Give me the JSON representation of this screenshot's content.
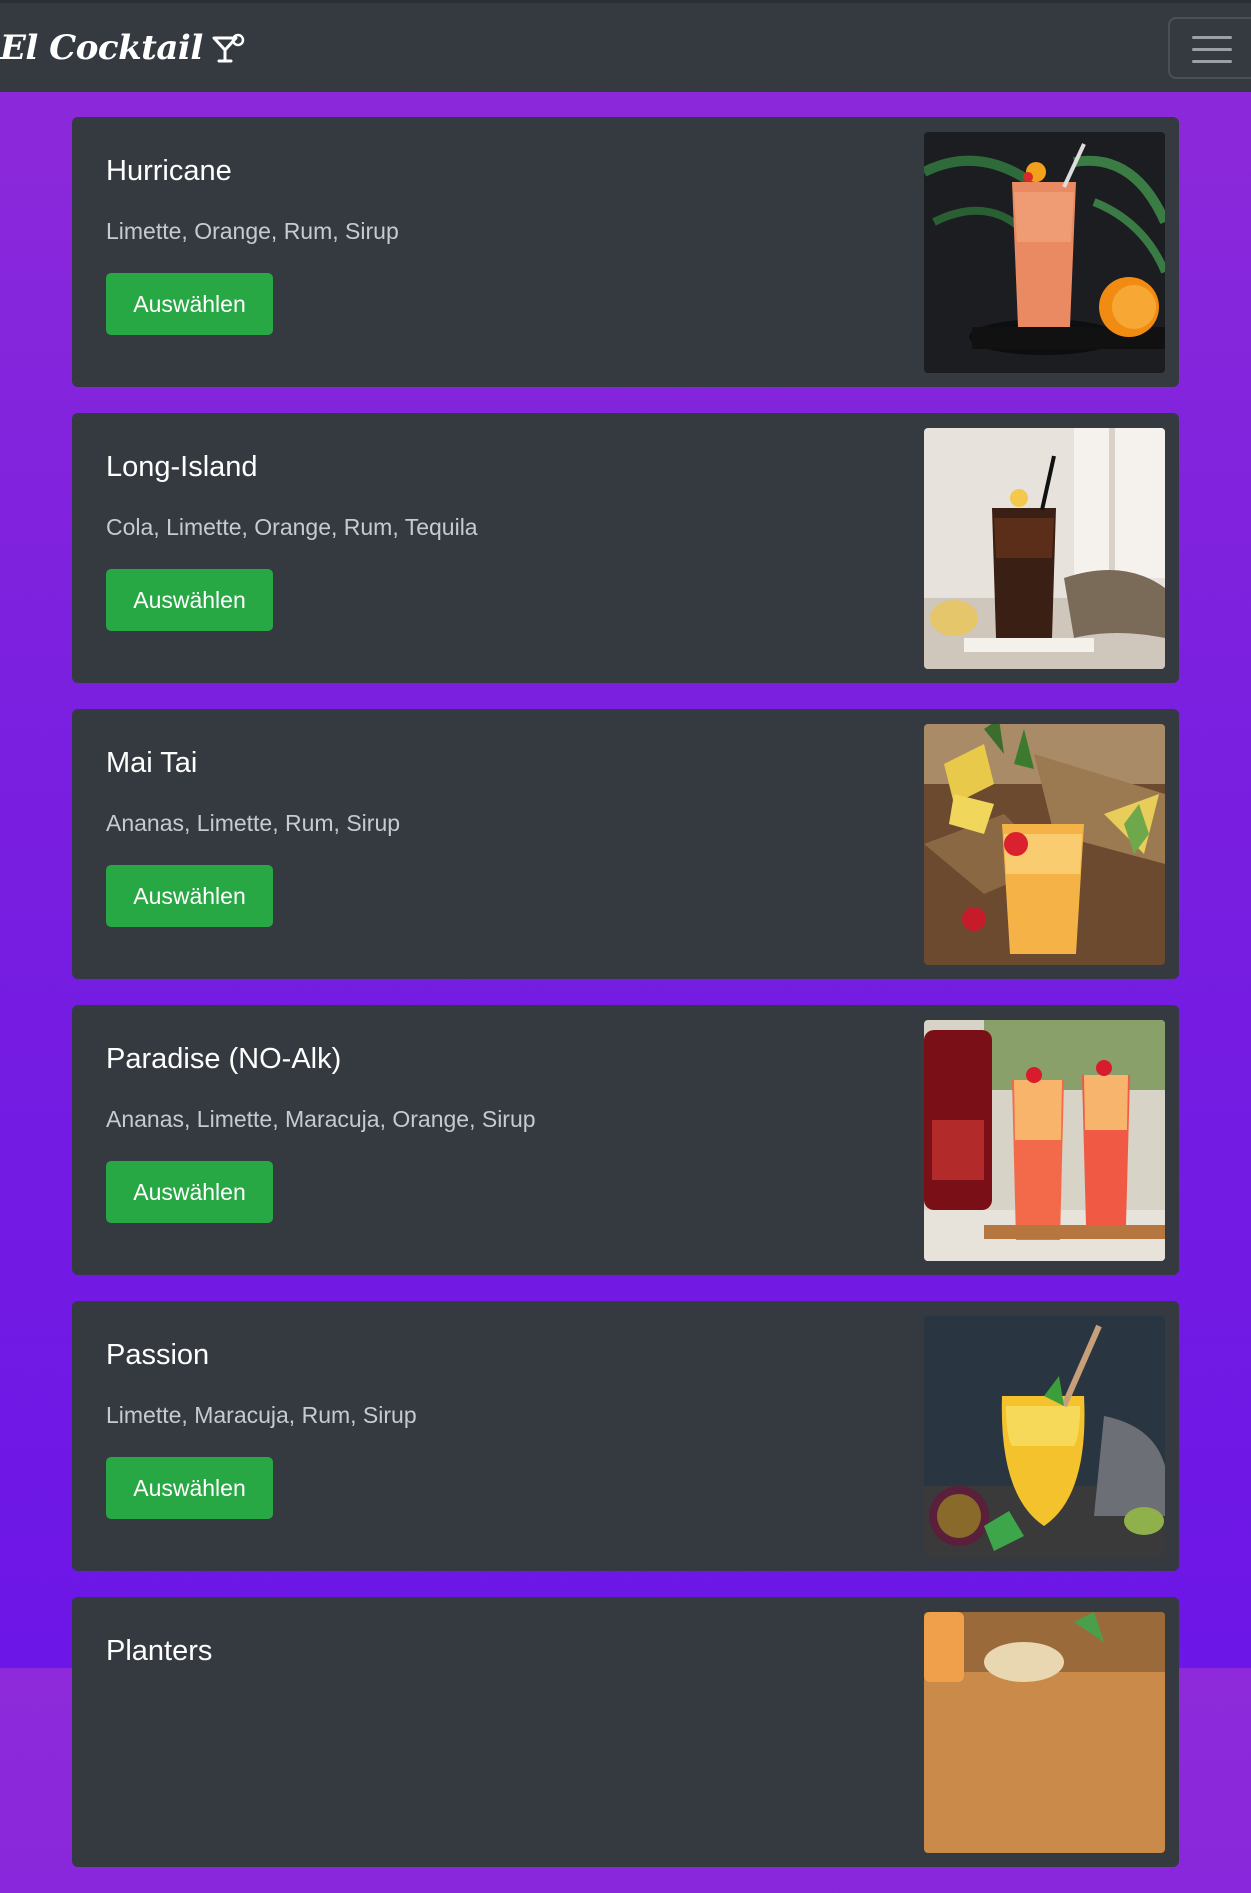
{
  "navbar": {
    "brand": "El Cocktail",
    "brand_icon": "cocktail-glass-icon",
    "toggler_icon": "hamburger-menu-icon"
  },
  "colors": {
    "navbar_bg": "#343a40",
    "card_bg": "#343a40",
    "button_bg": "#28a745",
    "page_gradient_top": "#8e2ad9",
    "page_gradient_bottom": "#6c16e7"
  },
  "cocktails": [
    {
      "name": "Hurricane",
      "ingredients": "Limette, Orange, Rum, Sirup",
      "button": "Auswählen"
    },
    {
      "name": "Long-Island",
      "ingredients": "Cola, Limette, Orange, Rum, Tequila",
      "button": "Auswählen"
    },
    {
      "name": "Mai Tai",
      "ingredients": "Ananas, Limette, Rum, Sirup",
      "button": "Auswählen"
    },
    {
      "name": "Paradise (NO-Alk)",
      "ingredients": "Ananas, Limette, Maracuja, Orange, Sirup",
      "button": "Auswählen"
    },
    {
      "name": "Passion",
      "ingredients": "Limette, Maracuja, Rum, Sirup",
      "button": "Auswählen"
    },
    {
      "name": "Planters",
      "ingredients": "",
      "button": ""
    }
  ]
}
